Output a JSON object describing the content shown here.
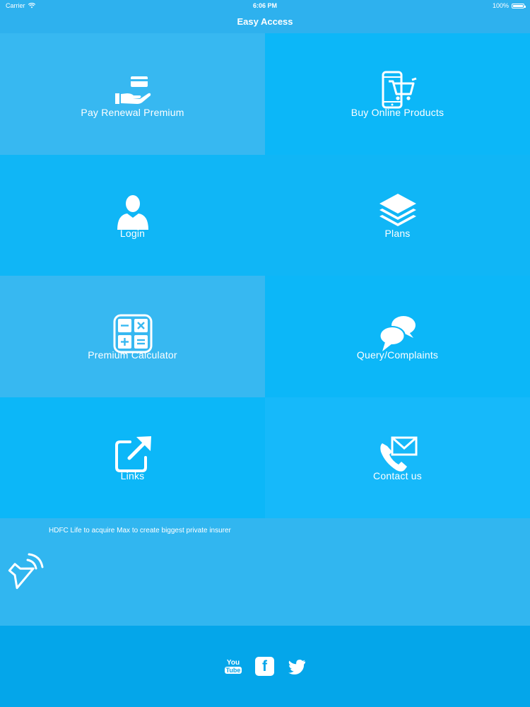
{
  "status_bar": {
    "carrier": "Carrier",
    "time": "6:06 PM",
    "battery": "100%"
  },
  "nav": {
    "title": "Easy Access"
  },
  "tiles": [
    {
      "label": "Pay Renewal Premium",
      "icon": "pay-premium-icon"
    },
    {
      "label": "Buy Online Products",
      "icon": "mobile-cart-icon"
    },
    {
      "label": "Login",
      "icon": "user-icon"
    },
    {
      "label": "Plans",
      "icon": "layers-icon"
    },
    {
      "label": "Premium Calculator",
      "icon": "calculator-icon"
    },
    {
      "label": "Query/Complaints",
      "icon": "chat-bubbles-icon"
    },
    {
      "label": "Links",
      "icon": "external-link-icon"
    },
    {
      "label": "Contact us",
      "icon": "phone-mail-icon"
    }
  ],
  "news": {
    "headline": "HDFC Life to acquire Max to create biggest private insurer",
    "icon": "speaker-icon"
  },
  "footer": {
    "youtube": {
      "top": "You",
      "bottom": "Tube"
    },
    "facebook": "f",
    "twitter": "twitter-icon"
  },
  "colors": {
    "primary": "#2eb1ee",
    "tile_light": "#37b8f1",
    "tile_dark": "#0cb7f8",
    "footer": "#04a6ea"
  }
}
